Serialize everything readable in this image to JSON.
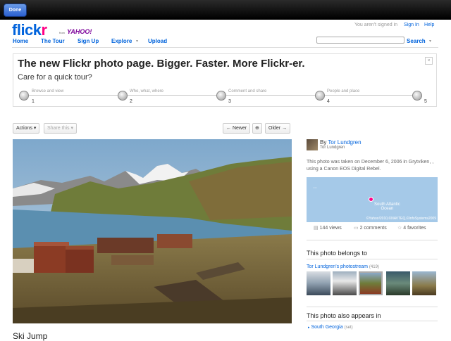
{
  "toolbar": {
    "done_label": "Done"
  },
  "header": {
    "logo_part1": "flick",
    "logo_part2": "r",
    "logo_from": "from",
    "logo_yahoo": "YAHOO!",
    "signin_status": "You aren't signed in",
    "signin_label": "Sign In",
    "help_label": "Help",
    "nav": [
      "Home",
      "The Tour",
      "Sign Up",
      "Explore",
      "Upload"
    ],
    "search_placeholder": "",
    "search_label": "Search"
  },
  "tour": {
    "title": "The new Flickr photo page. Bigger. Faster. More Flickr-er.",
    "subtitle": "Care for a quick tour?",
    "close_label": "×",
    "steps": [
      {
        "label": "Browse and view",
        "num": "1"
      },
      {
        "label": "Who, what, where",
        "num": "2"
      },
      {
        "label": "Comment and share",
        "num": "3"
      },
      {
        "label": "People and place",
        "num": "4"
      },
      {
        "label": "",
        "num": "5"
      }
    ]
  },
  "photo_toolbar": {
    "actions_label": "Actions",
    "share_label": "Share this",
    "newer_label": "Newer",
    "older_label": "Older"
  },
  "photo": {
    "title": "Ski Jump"
  },
  "sidebar": {
    "by_prefix": "By",
    "author": "Tor Lundgren",
    "author_sub": "Tor Lundgren",
    "taken_text": "This photo was taken on December 6, 2006 in Grytviken, , using a Canon EOS Digital Rebel.",
    "map_label_line1": "South Atlantic",
    "map_label_line2": "Ocean",
    "map_copyright": "©Yahoo!2010,©NAVTEQ,©InfoSystems2009",
    "views": "144 views",
    "comments": "2 comments",
    "favorites": "4 favorites",
    "belongs_head": "This photo belongs to",
    "stream_link": "Tor Lundgren's photostream",
    "stream_count": "(419)",
    "appears_head": "This photo also appears in",
    "set_link": "South Georgia",
    "set_suffix": "(set)"
  },
  "colors": {
    "flickr_blue": "#0063dc",
    "flickr_pink": "#ff0084",
    "yahoo_purple": "#7b0099"
  }
}
